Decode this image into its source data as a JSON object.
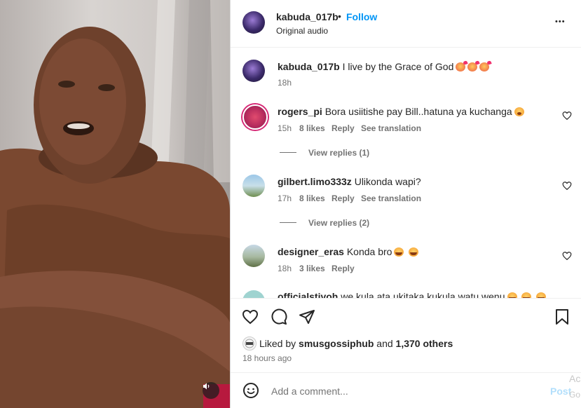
{
  "post": {
    "username": "kabuda_017b",
    "separator": "•",
    "follow_label": "Follow",
    "audio": "Original audio",
    "more_label": "•••"
  },
  "caption": {
    "username": "kabuda_017b",
    "text": "I live by the Grace of God",
    "emojis": [
      "kissing-face",
      "kissing-face",
      "kissing-face"
    ],
    "time": "18h"
  },
  "comments": [
    {
      "username": "rogers_pi",
      "text": "Bora usiitishe pay Bill..hatuna ya kuchanga",
      "emoji": "worried-face",
      "time": "15h",
      "likes": "8 likes",
      "reply_label": "Reply",
      "translation_label": "See translation",
      "view_replies": "View replies (1)"
    },
    {
      "username": "gilbert.limo333z",
      "text": "Ulikonda wapi?",
      "time": "17h",
      "likes": "8 likes",
      "reply_label": "Reply",
      "translation_label": "See translation",
      "view_replies": "View replies (2)"
    },
    {
      "username": "designer_eras",
      "text": "Konda bro",
      "emojis": [
        "laughing-face",
        "laughing-face"
      ],
      "time": "18h",
      "likes": "3 likes",
      "reply_label": "Reply"
    },
    {
      "username": "officialstivoh",
      "text": "we kula ata ukitaka kukula watu wenu",
      "emojis": [
        "laughing-face",
        "laughing-face",
        "laughing-face"
      ]
    }
  ],
  "likes": {
    "prefix": "Liked by",
    "user": "smusgossiphub",
    "middle": "and",
    "count": "1,370 others",
    "time": "18 hours ago"
  },
  "add_comment": {
    "placeholder": "Add a comment...",
    "post_label": "Post"
  },
  "watermark": {
    "line1": "Ac",
    "line2": "Go"
  },
  "colors": {
    "follow": "#0095f6",
    "post_disabled": "#b2dffc",
    "text": "#262626",
    "muted": "#737373"
  }
}
